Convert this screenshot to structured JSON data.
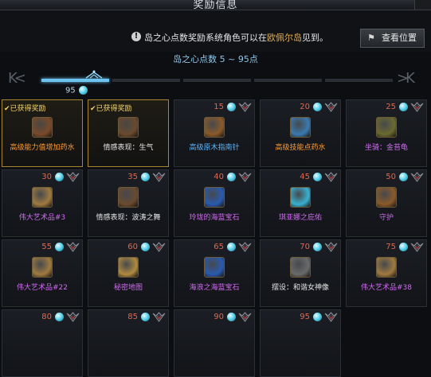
{
  "window": {
    "title": "奖励信息"
  },
  "info": {
    "text_before": "岛之心点数奖励系统角色可以在",
    "highlight": "欧佩尔岛",
    "text_after": "见到。",
    "view_button": "查看位置"
  },
  "range_label": "岛之心点数 5 ~ 95点",
  "progress": {
    "current_points": "95",
    "active_segment": 1,
    "total_segments": 5
  },
  "rewards": [
    {
      "claimed": true,
      "claimed_label": "✔已获得奖励",
      "cost": "",
      "name": "高级能力值增加药水",
      "quality": "orange",
      "icon_color": "#7a4a2a"
    },
    {
      "claimed": true,
      "claimed_label": "✔已获得奖励",
      "cost": "",
      "name": "情感表现：生气",
      "quality": "white",
      "icon_color": "#6a4a30"
    },
    {
      "claimed": false,
      "claimed_label": "",
      "cost": "15",
      "name": "高级原木指南针",
      "quality": "blue",
      "icon_color": "#8a5a2a"
    },
    {
      "claimed": false,
      "claimed_label": "",
      "cost": "20",
      "name": "高级技能点药水",
      "quality": "orange",
      "icon_color": "#3a7ab0"
    },
    {
      "claimed": false,
      "claimed_label": "",
      "cost": "25",
      "name": "坐骑：金苔龟",
      "quality": "purple",
      "icon_color": "#6a6a30"
    },
    {
      "claimed": false,
      "claimed_label": "",
      "cost": "30",
      "name": "伟大艺术品#3",
      "quality": "purple",
      "icon_color": "#a07a40"
    },
    {
      "claimed": false,
      "claimed_label": "",
      "cost": "35",
      "name": "情感表现：波涛之舞",
      "quality": "white",
      "icon_color": "#6a4a30"
    },
    {
      "claimed": false,
      "claimed_label": "",
      "cost": "40",
      "name": "玲珑的海蓝宝石",
      "quality": "purple",
      "icon_color": "#2a5ab0"
    },
    {
      "claimed": false,
      "claimed_label": "",
      "cost": "45",
      "name": "琪亚娜之庇佑",
      "quality": "purple",
      "icon_color": "#3ab0d0"
    },
    {
      "claimed": false,
      "claimed_label": "",
      "cost": "50",
      "name": "守护",
      "quality": "purple",
      "icon_color": "#8a5a2a"
    },
    {
      "claimed": false,
      "claimed_label": "",
      "cost": "55",
      "name": "伟大艺术品#22",
      "quality": "purple",
      "icon_color": "#a07a40"
    },
    {
      "claimed": false,
      "claimed_label": "",
      "cost": "60",
      "name": "秘密地图",
      "quality": "purple",
      "icon_color": "#b08a40"
    },
    {
      "claimed": false,
      "claimed_label": "",
      "cost": "65",
      "name": "海浪之海蓝宝石",
      "quality": "purple",
      "icon_color": "#2a5ab0"
    },
    {
      "claimed": false,
      "claimed_label": "",
      "cost": "70",
      "name": "摆设：和谐女神像",
      "quality": "white",
      "icon_color": "#6a6a6a"
    },
    {
      "claimed": false,
      "claimed_label": "",
      "cost": "75",
      "name": "伟大艺术品#38",
      "quality": "purple",
      "icon_color": "#a07a40"
    },
    {
      "claimed": false,
      "claimed_label": "",
      "cost": "80",
      "name": "",
      "quality": "purple",
      "icon_color": ""
    },
    {
      "claimed": false,
      "claimed_label": "",
      "cost": "85",
      "name": "",
      "quality": "purple",
      "icon_color": ""
    },
    {
      "claimed": false,
      "claimed_label": "",
      "cost": "90",
      "name": "",
      "quality": "purple",
      "icon_color": ""
    },
    {
      "claimed": false,
      "claimed_label": "",
      "cost": "95",
      "name": "",
      "quality": "purple",
      "icon_color": ""
    }
  ]
}
